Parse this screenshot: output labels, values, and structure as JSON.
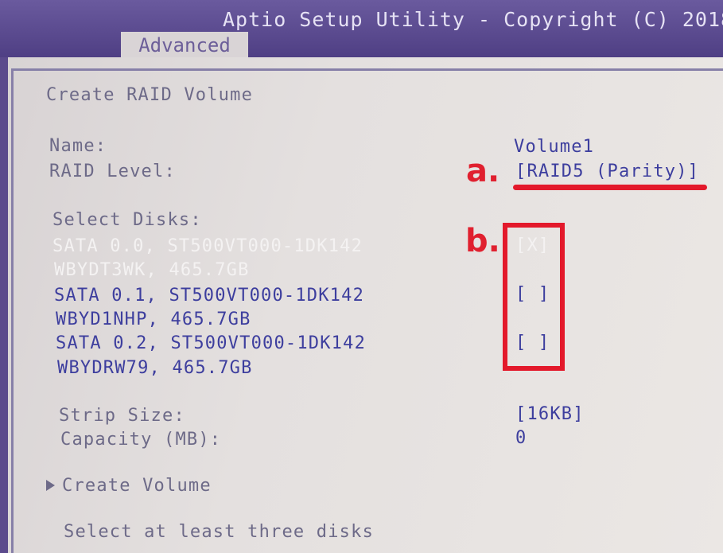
{
  "header": {
    "title": "Aptio Setup Utility - Copyright (C) 2018",
    "tab": "Advanced"
  },
  "screen": {
    "heading": "Create RAID Volume",
    "name_label": "Name:",
    "name_value": "Volume1",
    "raid_label": "RAID Level:",
    "raid_value": "[RAID5 (Parity)]",
    "select_disks_label": "Select Disks:",
    "disks": [
      {
        "line1": "SATA 0.0, ST500VT000-1DK142",
        "line2": "WBYDT3WK, 465.7GB",
        "checkbox": "[X]"
      },
      {
        "line1": "SATA 0.1, ST500VT000-1DK142",
        "line2": "WBYD1NHP, 465.7GB",
        "checkbox": "[ ]"
      },
      {
        "line1": "SATA 0.2, ST500VT000-1DK142",
        "line2": "WBYDRW79, 465.7GB",
        "checkbox": "[ ]"
      }
    ],
    "strip_label": "Strip Size:",
    "strip_value": "[16KB]",
    "capacity_label": "Capacity (MB):",
    "capacity_value": "0",
    "create_volume": "Create Volume",
    "help_text": "Select at least three disks"
  },
  "annotations": {
    "a": "a.",
    "b": "b."
  },
  "colors": {
    "header": "#5b4a8c",
    "value_text": "#3d3e9e",
    "label_text": "#6d6a88",
    "highlight": "#e3192b"
  }
}
